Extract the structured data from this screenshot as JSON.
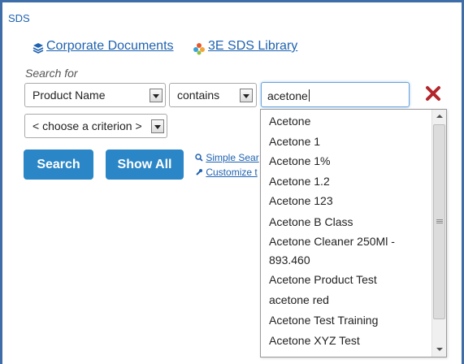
{
  "app": {
    "title": "SDS"
  },
  "nav": {
    "corporate_label": "Corporate Documents",
    "library_label": "3E SDS Library"
  },
  "search": {
    "section_label": "Search for",
    "field_value": "Product Name",
    "operator_value": "contains",
    "query_value": "acetone",
    "criterion_value": "< choose a criterion >"
  },
  "actions": {
    "search_label": "Search",
    "show_all_label": "Show All",
    "simple_search_label": "Simple Sear",
    "customize_label": "Customize t"
  },
  "suggestions": [
    "Acetone",
    "Acetone 1",
    "Acetone 1%",
    "Acetone 1.2",
    "Acetone 123",
    "Acetone B Class",
    "Acetone Cleaner 250Ml - 893.460",
    "Acetone Product Test",
    "acetone red",
    "Acetone Test Training",
    "Acetone XYZ Test"
  ],
  "colors": {
    "accent": "#2a86c6",
    "link": "#1f62b0",
    "frame": "#3f6da8",
    "close": "#b3262b"
  },
  "icons": {
    "corporate": "stack-layers-icon",
    "library": "flower-icon",
    "simple_search": "search-icon",
    "customize": "wrench-icon",
    "clear": "close-icon"
  }
}
